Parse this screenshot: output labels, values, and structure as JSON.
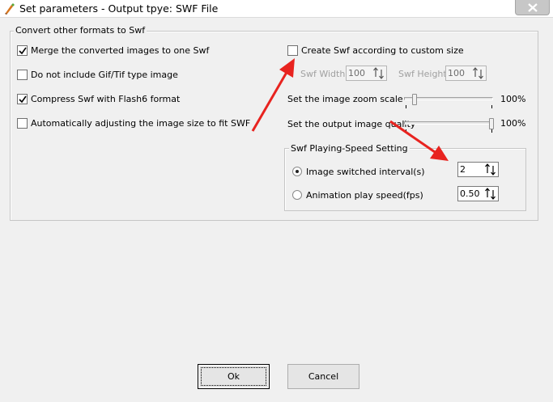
{
  "window": {
    "title": "Set parameters - Output tpye: SWF File"
  },
  "convert_group": {
    "label": "Convert other formats to Swf",
    "options": [
      {
        "label": "Merge the converted images to one Swf",
        "checked": true
      },
      {
        "label": "Do not include Gif/Tif type image",
        "checked": false
      },
      {
        "label": "Compress Swf with Flash6 format",
        "checked": true
      },
      {
        "label": "Automatically adjusting the image size to fit SWF",
        "checked": false
      }
    ]
  },
  "custom_size": {
    "label": "Create Swf according to custom size",
    "checked": false,
    "width_label": "Swf Width",
    "width_value": "100",
    "height_label": "Swf Height",
    "height_value": "100"
  },
  "zoom": {
    "label": "Set the image zoom scale",
    "value_text": "100%",
    "fraction": 0.1
  },
  "quality": {
    "label": "Set the output image quality",
    "value_text": "100%",
    "fraction": 1.0
  },
  "speed_group": {
    "label": "Swf Playing-Speed Setting",
    "interval": {
      "label": "Image switched interval(s)",
      "value": "2",
      "selected": true
    },
    "fps": {
      "label": "Animation play speed(fps)",
      "value": "0.50",
      "selected": false
    }
  },
  "buttons": {
    "ok": "Ok",
    "cancel": "Cancel"
  },
  "colors": {
    "annotation_arrow": "#e8231f"
  }
}
